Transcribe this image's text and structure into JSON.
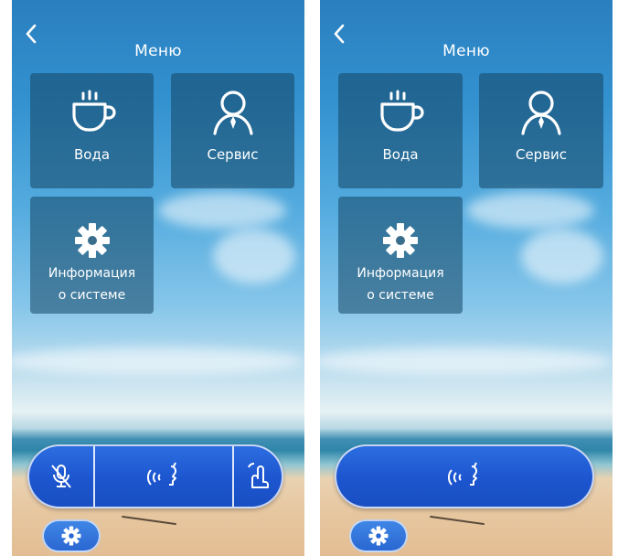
{
  "screens": [
    {
      "title": "Меню",
      "tiles": {
        "water": "Вода",
        "service": "Сервис",
        "info_line1": "Информация",
        "info_line2": "о системе"
      },
      "bottom_bar": [
        "mute-mic-icon",
        "voice-icon",
        "wave-hand-icon"
      ]
    },
    {
      "title": "Меню",
      "tiles": {
        "water": "Вода",
        "service": "Сервис",
        "info_line1": "Информация",
        "info_line2": "о системе"
      },
      "bottom_bar": [
        "voice-icon"
      ]
    }
  ],
  "colors": {
    "bar_blue": "#1c55cf",
    "tile_overlay": "#14465f"
  }
}
